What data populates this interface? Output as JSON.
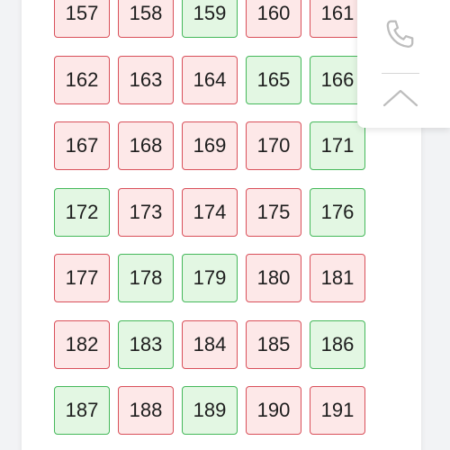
{
  "seats": [
    {
      "number": "157",
      "status": "sold"
    },
    {
      "number": "158",
      "status": "sold"
    },
    {
      "number": "159",
      "status": "available"
    },
    {
      "number": "160",
      "status": "sold"
    },
    {
      "number": "161",
      "status": "sold"
    },
    {
      "number": "162",
      "status": "sold"
    },
    {
      "number": "163",
      "status": "sold"
    },
    {
      "number": "164",
      "status": "sold"
    },
    {
      "number": "165",
      "status": "available"
    },
    {
      "number": "166",
      "status": "available"
    },
    {
      "number": "167",
      "status": "sold"
    },
    {
      "number": "168",
      "status": "sold"
    },
    {
      "number": "169",
      "status": "sold"
    },
    {
      "number": "170",
      "status": "sold"
    },
    {
      "number": "171",
      "status": "available"
    },
    {
      "number": "172",
      "status": "available"
    },
    {
      "number": "173",
      "status": "sold"
    },
    {
      "number": "174",
      "status": "sold"
    },
    {
      "number": "175",
      "status": "sold"
    },
    {
      "number": "176",
      "status": "available"
    },
    {
      "number": "177",
      "status": "sold"
    },
    {
      "number": "178",
      "status": "available"
    },
    {
      "number": "179",
      "status": "available"
    },
    {
      "number": "180",
      "status": "sold"
    },
    {
      "number": "181",
      "status": "sold"
    },
    {
      "number": "182",
      "status": "sold"
    },
    {
      "number": "183",
      "status": "available"
    },
    {
      "number": "184",
      "status": "sold"
    },
    {
      "number": "185",
      "status": "sold"
    },
    {
      "number": "186",
      "status": "available"
    },
    {
      "number": "187",
      "status": "available"
    },
    {
      "number": "188",
      "status": "sold"
    },
    {
      "number": "189",
      "status": "available"
    },
    {
      "number": "190",
      "status": "sold"
    },
    {
      "number": "191",
      "status": "sold"
    }
  ],
  "colors": {
    "sold_fill": "#fde8e8",
    "sold_border": "#d9505a",
    "available_fill": "#e3f7e3",
    "available_border": "#45b85a",
    "icon": "#bdbdbd"
  },
  "side_panel": {
    "buttons": [
      {
        "icon": "phone-icon"
      },
      {
        "icon": "chevron-up-icon"
      }
    ]
  }
}
